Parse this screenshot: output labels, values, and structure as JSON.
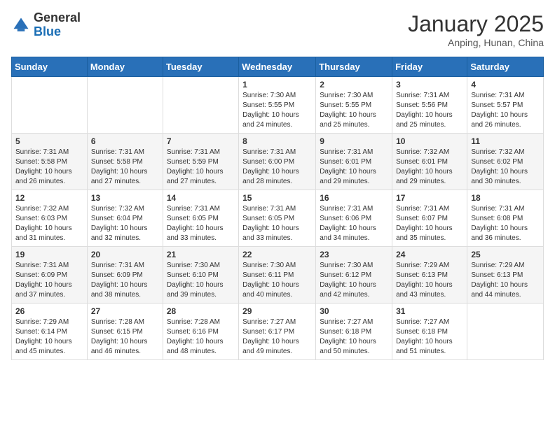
{
  "logo": {
    "general": "General",
    "blue": "Blue"
  },
  "header": {
    "month_year": "January 2025",
    "location": "Anping, Hunan, China"
  },
  "days_of_week": [
    "Sunday",
    "Monday",
    "Tuesday",
    "Wednesday",
    "Thursday",
    "Friday",
    "Saturday"
  ],
  "weeks": [
    [
      {
        "day": "",
        "info": ""
      },
      {
        "day": "",
        "info": ""
      },
      {
        "day": "",
        "info": ""
      },
      {
        "day": "1",
        "info": "Sunrise: 7:30 AM\nSunset: 5:55 PM\nDaylight: 10 hours and 24 minutes."
      },
      {
        "day": "2",
        "info": "Sunrise: 7:30 AM\nSunset: 5:55 PM\nDaylight: 10 hours and 25 minutes."
      },
      {
        "day": "3",
        "info": "Sunrise: 7:31 AM\nSunset: 5:56 PM\nDaylight: 10 hours and 25 minutes."
      },
      {
        "day": "4",
        "info": "Sunrise: 7:31 AM\nSunset: 5:57 PM\nDaylight: 10 hours and 26 minutes."
      }
    ],
    [
      {
        "day": "5",
        "info": "Sunrise: 7:31 AM\nSunset: 5:58 PM\nDaylight: 10 hours and 26 minutes."
      },
      {
        "day": "6",
        "info": "Sunrise: 7:31 AM\nSunset: 5:58 PM\nDaylight: 10 hours and 27 minutes."
      },
      {
        "day": "7",
        "info": "Sunrise: 7:31 AM\nSunset: 5:59 PM\nDaylight: 10 hours and 27 minutes."
      },
      {
        "day": "8",
        "info": "Sunrise: 7:31 AM\nSunset: 6:00 PM\nDaylight: 10 hours and 28 minutes."
      },
      {
        "day": "9",
        "info": "Sunrise: 7:31 AM\nSunset: 6:01 PM\nDaylight: 10 hours and 29 minutes."
      },
      {
        "day": "10",
        "info": "Sunrise: 7:32 AM\nSunset: 6:01 PM\nDaylight: 10 hours and 29 minutes."
      },
      {
        "day": "11",
        "info": "Sunrise: 7:32 AM\nSunset: 6:02 PM\nDaylight: 10 hours and 30 minutes."
      }
    ],
    [
      {
        "day": "12",
        "info": "Sunrise: 7:32 AM\nSunset: 6:03 PM\nDaylight: 10 hours and 31 minutes."
      },
      {
        "day": "13",
        "info": "Sunrise: 7:32 AM\nSunset: 6:04 PM\nDaylight: 10 hours and 32 minutes."
      },
      {
        "day": "14",
        "info": "Sunrise: 7:31 AM\nSunset: 6:05 PM\nDaylight: 10 hours and 33 minutes."
      },
      {
        "day": "15",
        "info": "Sunrise: 7:31 AM\nSunset: 6:05 PM\nDaylight: 10 hours and 33 minutes."
      },
      {
        "day": "16",
        "info": "Sunrise: 7:31 AM\nSunset: 6:06 PM\nDaylight: 10 hours and 34 minutes."
      },
      {
        "day": "17",
        "info": "Sunrise: 7:31 AM\nSunset: 6:07 PM\nDaylight: 10 hours and 35 minutes."
      },
      {
        "day": "18",
        "info": "Sunrise: 7:31 AM\nSunset: 6:08 PM\nDaylight: 10 hours and 36 minutes."
      }
    ],
    [
      {
        "day": "19",
        "info": "Sunrise: 7:31 AM\nSunset: 6:09 PM\nDaylight: 10 hours and 37 minutes."
      },
      {
        "day": "20",
        "info": "Sunrise: 7:31 AM\nSunset: 6:09 PM\nDaylight: 10 hours and 38 minutes."
      },
      {
        "day": "21",
        "info": "Sunrise: 7:30 AM\nSunset: 6:10 PM\nDaylight: 10 hours and 39 minutes."
      },
      {
        "day": "22",
        "info": "Sunrise: 7:30 AM\nSunset: 6:11 PM\nDaylight: 10 hours and 40 minutes."
      },
      {
        "day": "23",
        "info": "Sunrise: 7:30 AM\nSunset: 6:12 PM\nDaylight: 10 hours and 42 minutes."
      },
      {
        "day": "24",
        "info": "Sunrise: 7:29 AM\nSunset: 6:13 PM\nDaylight: 10 hours and 43 minutes."
      },
      {
        "day": "25",
        "info": "Sunrise: 7:29 AM\nSunset: 6:13 PM\nDaylight: 10 hours and 44 minutes."
      }
    ],
    [
      {
        "day": "26",
        "info": "Sunrise: 7:29 AM\nSunset: 6:14 PM\nDaylight: 10 hours and 45 minutes."
      },
      {
        "day": "27",
        "info": "Sunrise: 7:28 AM\nSunset: 6:15 PM\nDaylight: 10 hours and 46 minutes."
      },
      {
        "day": "28",
        "info": "Sunrise: 7:28 AM\nSunset: 6:16 PM\nDaylight: 10 hours and 48 minutes."
      },
      {
        "day": "29",
        "info": "Sunrise: 7:27 AM\nSunset: 6:17 PM\nDaylight: 10 hours and 49 minutes."
      },
      {
        "day": "30",
        "info": "Sunrise: 7:27 AM\nSunset: 6:18 PM\nDaylight: 10 hours and 50 minutes."
      },
      {
        "day": "31",
        "info": "Sunrise: 7:27 AM\nSunset: 6:18 PM\nDaylight: 10 hours and 51 minutes."
      },
      {
        "day": "",
        "info": ""
      }
    ]
  ]
}
